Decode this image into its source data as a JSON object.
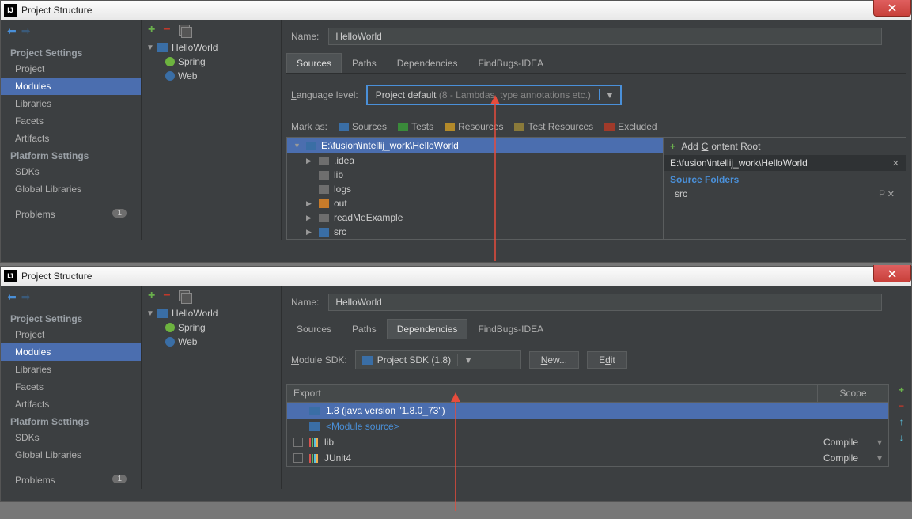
{
  "win1": {
    "title": "Project Structure",
    "nav": {
      "sect1": "Project Settings",
      "project": "Project",
      "modules": "Modules",
      "libraries": "Libraries",
      "facets": "Facets",
      "artifacts": "Artifacts",
      "sect2": "Platform Settings",
      "sdks": "SDKs",
      "globlib": "Global Libraries",
      "problems": "Problems",
      "badge": "1"
    },
    "tree": {
      "root": "HelloWorld",
      "spring": "Spring",
      "web": "Web"
    },
    "name_label": "Name:",
    "name_value": "HelloWorld",
    "tabs": {
      "sources": "Sources",
      "paths": "Paths",
      "deps": "Dependencies",
      "fb": "FindBugs-IDEA"
    },
    "lang_label": "Language level:",
    "lang_value": "Project default",
    "lang_hint": " (8 - Lambdas, type annotations etc.)",
    "markas": {
      "label": "Mark as:",
      "sources": "Sources",
      "tests": "Tests",
      "res": "Resources",
      "tres": "Test Resources",
      "excl": "Excluded"
    },
    "srctree": {
      "root": "E:\\fusion\\intellij_work\\HelloWorld",
      "idea": ".idea",
      "lib": "lib",
      "logs": "logs",
      "out": "out",
      "readme": "readMeExample",
      "src": "src"
    },
    "cr": {
      "add": "Add Content Root",
      "path": "E:\\fusion\\intellij_work\\HelloWorld",
      "sf": "Source Folders",
      "src": "src"
    }
  },
  "win2": {
    "title": "Project Structure",
    "nav": {
      "sect1": "Project Settings",
      "project": "Project",
      "modules": "Modules",
      "libraries": "Libraries",
      "facets": "Facets",
      "artifacts": "Artifacts",
      "sect2": "Platform Settings",
      "sdks": "SDKs",
      "globlib": "Global Libraries",
      "problems": "Problems",
      "badge": "1"
    },
    "tree": {
      "root": "HelloWorld",
      "spring": "Spring",
      "web": "Web"
    },
    "name_label": "Name:",
    "name_value": "HelloWorld",
    "tabs": {
      "sources": "Sources",
      "paths": "Paths",
      "deps": "Dependencies",
      "fb": "FindBugs-IDEA"
    },
    "sdk_label": "Module SDK:",
    "sdk_value": "Project SDK (1.8)",
    "btn_new": "New...",
    "btn_edit": "Edit",
    "table": {
      "h1": "Export",
      "h2": "Scope",
      "r0": "1.8 (java version \"1.8.0_73\")",
      "r1": "<Module source>",
      "r2": "lib",
      "r3": "JUnit4",
      "compile": "Compile"
    }
  }
}
